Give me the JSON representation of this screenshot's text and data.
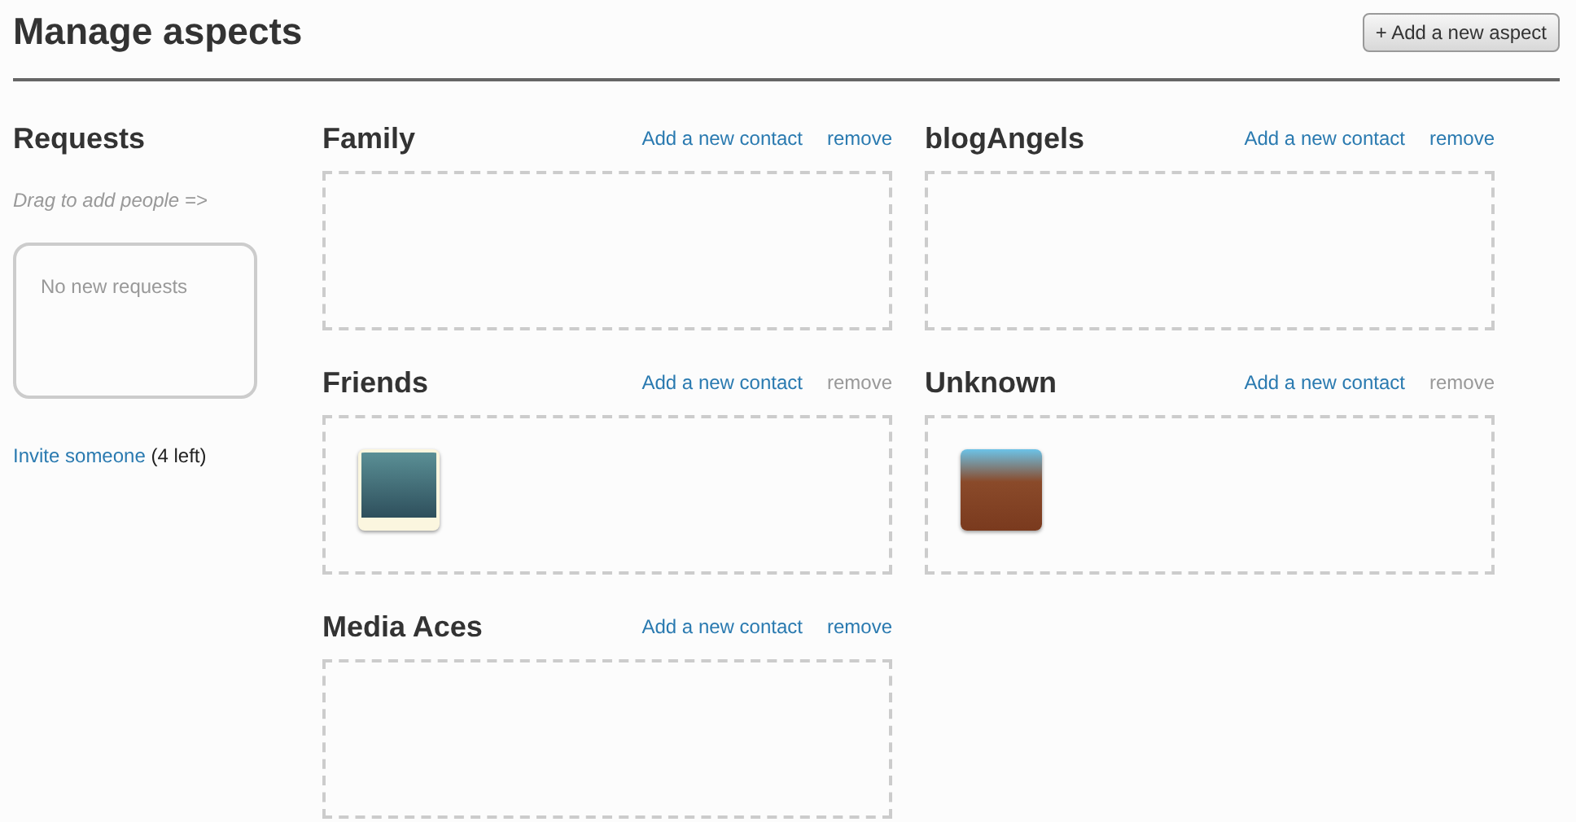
{
  "header": {
    "title": "Manage aspects",
    "add_button": "+ Add a new aspect"
  },
  "requests": {
    "title": "Requests",
    "hint": "Drag to add people =>",
    "empty_text": "No new requests",
    "invite_link": "Invite someone",
    "invite_count": "(4 left)"
  },
  "aspects": [
    {
      "name": "Family",
      "add_link": "Add a new contact",
      "remove_link": "remove",
      "remove_disabled": false
    },
    {
      "name": "blogAngels",
      "add_link": "Add a new contact",
      "remove_link": "remove",
      "remove_disabled": false
    },
    {
      "name": "Friends",
      "add_link": "Add a new contact",
      "remove_link": "remove",
      "remove_disabled": true,
      "contacts": [
        {
          "kind": "framed"
        }
      ]
    },
    {
      "name": "Unknown",
      "add_link": "Add a new contact",
      "remove_link": "remove",
      "remove_disabled": true,
      "contacts": [
        {
          "kind": "plain"
        }
      ]
    },
    {
      "name": "Media Aces",
      "add_link": "Add a new contact",
      "remove_link": "remove",
      "remove_disabled": false
    }
  ]
}
